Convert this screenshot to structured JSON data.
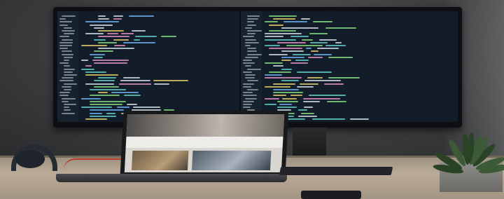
{
  "scene": {
    "subject": "photo",
    "colors": {
      "code_green": "#7fd17a",
      "code_blue": "#6aa8e8",
      "code_white": "#c9d3dc",
      "code_yellow": "#d9c469",
      "code_pink": "#d98cc0",
      "code_teal": "#5fc6c0"
    }
  }
}
